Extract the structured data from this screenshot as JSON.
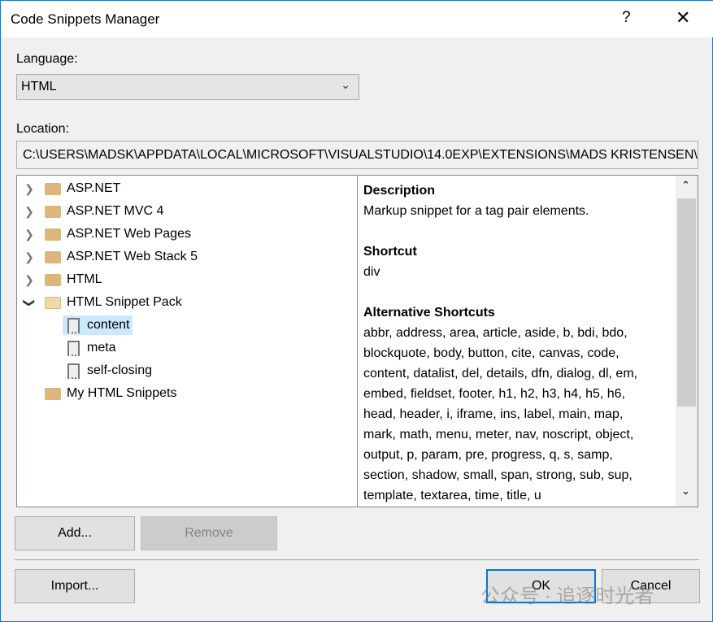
{
  "window": {
    "title": "Code Snippets Manager",
    "help": "?",
    "close": "✕"
  },
  "language": {
    "label": "Language:",
    "value": "HTML"
  },
  "location": {
    "label": "Location:",
    "value": "C:\\USERS\\MADSK\\APPDATA\\LOCAL\\MICROSOFT\\VISUALSTUDIO\\14.0EXP\\EXTENSIONS\\MADS KRISTENSEN\\HTML SNIPPET PACK"
  },
  "tree": [
    {
      "label": "ASP.NET",
      "type": "folder",
      "expander": "collapsed"
    },
    {
      "label": "ASP.NET MVC 4",
      "type": "folder",
      "expander": "collapsed"
    },
    {
      "label": "ASP.NET Web Pages",
      "type": "folder",
      "expander": "collapsed"
    },
    {
      "label": "ASP.NET Web Stack 5",
      "type": "folder",
      "expander": "collapsed"
    },
    {
      "label": "HTML",
      "type": "folder",
      "expander": "collapsed"
    },
    {
      "label": "HTML Snippet Pack",
      "type": "folder",
      "expander": "expanded"
    },
    {
      "label": "content",
      "type": "snippet",
      "selected": true
    },
    {
      "label": "meta",
      "type": "snippet"
    },
    {
      "label": "self-closing",
      "type": "snippet"
    },
    {
      "label": "My HTML Snippets",
      "type": "folder",
      "expander": "none"
    }
  ],
  "details": {
    "description_heading": "Description",
    "description": "Markup snippet for a tag pair elements.",
    "shortcut_heading": "Shortcut",
    "shortcut": "div",
    "alt_heading": "Alternative Shortcuts",
    "alt_lines": [
      "abbr, address, area, article, aside, b, bdi, bdo,",
      "blockquote, body, button, cite, canvas, code,",
      "content, datalist, del, details, dfn, dialog, dl, em,",
      "embed, fieldset, footer, h1, h2, h3, h4, h5, h6,",
      "head, header, i, iframe, ins, label, main, map,",
      "mark, math, menu, meter, nav, noscript, object,",
      "output, p, param, pre, progress, q, s, samp,",
      "section, shadow, small, span, strong, sub, sup,",
      "template, textarea, time, title, u"
    ]
  },
  "buttons": {
    "add": "Add...",
    "remove": "Remove",
    "import": "Import...",
    "ok": "OK",
    "cancel": "Cancel"
  },
  "watermark": "公众号 · 追逐时光者"
}
